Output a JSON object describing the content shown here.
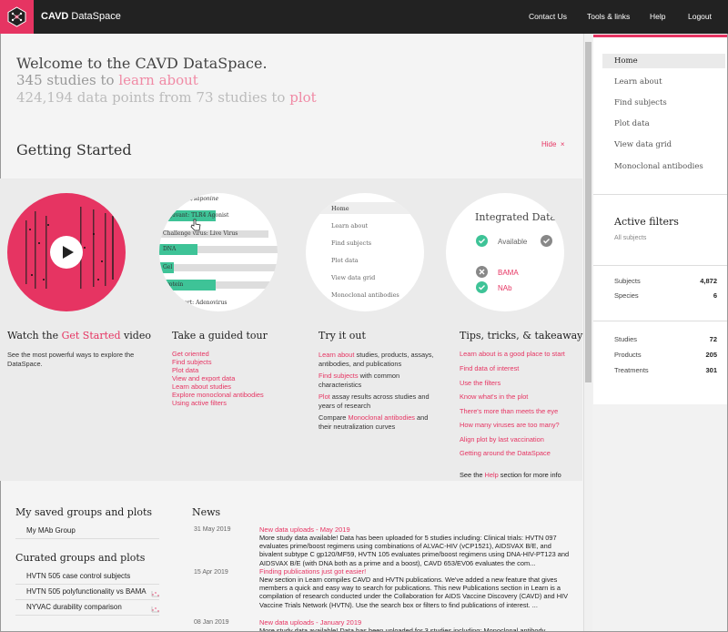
{
  "header": {
    "app_name_bold": "CAVD",
    "app_name_thin": "DataSpace",
    "nav": [
      "Contact Us",
      "Tools & links",
      "Help",
      "Logout"
    ]
  },
  "welcome": {
    "line1": "Welcome to the CAVD DataSpace.",
    "line2_prefix": "345 studies to ",
    "line2_link": "learn about",
    "line3_prefix": "424,194 data points from 73 studies to ",
    "line3_link": "plot"
  },
  "getting_started": {
    "title": "Getting Started",
    "hide": "Hide",
    "hide_icon": "×"
  },
  "cards": {
    "video": {
      "title_prefix": "Watch the ",
      "title_link": "Get Started",
      "title_suffix": " video",
      "text": "See the most powerful ways to explore the DataSpace."
    },
    "tour": {
      "title": "Take a guided tour",
      "links": [
        "Get oriented",
        "Find subjects",
        "Plot data",
        "View and export data",
        "Learn about studies",
        "Explore monoclonal antibodies",
        "Using active filters"
      ],
      "preview_rows": [
        "Adjuvant: TLR4 Agonist",
        "Challenge virus: Live Virus",
        "DNA",
        "Gel",
        "Protein",
        "Insert: Adenovirus"
      ],
      "preview_top": "Alum/saponine"
    },
    "try": {
      "title": "Try it out",
      "items": [
        {
          "link": "Learn about",
          "text": " studies, products, assays, antibodies, and publications"
        },
        {
          "link": "Find subjects",
          "text": " with common characteristics"
        },
        {
          "link": "Plot",
          "text": " assay results across studies and years of research"
        },
        {
          "prefix": "Compare ",
          "link": "Monoclonal antibodies",
          "text": " and their neutralization curves"
        }
      ],
      "preview_items": [
        "Home",
        "Learn about",
        "Find subjects",
        "Plot data",
        "View data grid",
        "Monoclonal antibodies"
      ]
    },
    "tips": {
      "title": "Tips, tricks, & takeaways",
      "links": [
        "Learn about is a good place to start",
        "Find data of interest",
        "Use the filters",
        "Know what's in the plot",
        "There's more than meets the eye",
        "How many viruses are too many?",
        "Align plot by last vaccination",
        "Getting around the DataSpace"
      ],
      "footer_prefix": "See the ",
      "footer_link": "Help",
      "footer_suffix": " section for more info",
      "preview_title": "Integrated Data",
      "preview_available": "Available",
      "preview_items": [
        "BAMA",
        "NAb"
      ]
    }
  },
  "saved": {
    "title": "My saved groups and plots",
    "items": [
      "My MAb Group"
    ]
  },
  "curated": {
    "title": "Curated groups and plots",
    "items": [
      "HVTN 505 case control subjects",
      "HVTN 505 polyfunctionality vs BAMA",
      "NYVAC durability comparison"
    ]
  },
  "news": {
    "title": "News",
    "items": [
      {
        "date": "31 May 2019",
        "headline": "New data uploads - May 2019",
        "body": "More study data available! Data has been uploaded for 5 studies including: Clinical trials: HVTN 097 evaluates prime/boost regimens using combinations of ALVAC-HIV (vCP1521), AIDSVAX B/E, and bivalent subtype C gp120/MF59, HVTN 105 evaluates prime/boost regimens using DNA-HIV-PT123 and AIDSVAX B/E (with DNA both as a prime and a boost), CAVD 653/EV06 evaluates the com..."
      },
      {
        "date": "15 Apr 2019",
        "headline": "Finding publications just got easier!",
        "body": "New section in Learn compiles CAVD and HVTN publications. We've added a new feature that gives members a quick and easy way to search for publications. This new Publications section in Learn is a compilation of research conducted under the Collaboration for AIDS Vaccine Discovery (CAVD) and HIV Vaccine Trials Network (HVTN). Use the search box or filters to find publications of interest. ..."
      },
      {
        "date": "08 Jan 2019",
        "headline": "New data uploads - January 2019",
        "body": "More study data available! Data has been uploaded for 3 studies including: Monoclonal antibody"
      }
    ]
  },
  "sidebar": {
    "nav": [
      "Home",
      "Learn about",
      "Find subjects",
      "Plot data",
      "View data grid",
      "Monoclonal antibodies"
    ],
    "active_filters_title": "Active filters",
    "active_filters_sub": "All subjects",
    "stats1": [
      {
        "label": "Subjects",
        "value": "4,872"
      },
      {
        "label": "Species",
        "value": "6"
      }
    ],
    "stats2": [
      {
        "label": "Studies",
        "value": "72"
      },
      {
        "label": "Products",
        "value": "205"
      },
      {
        "label": "Treatments",
        "value": "301"
      }
    ]
  },
  "colors": {
    "accent": "#e63462",
    "header_bg": "#222222",
    "green": "#3ec397"
  }
}
